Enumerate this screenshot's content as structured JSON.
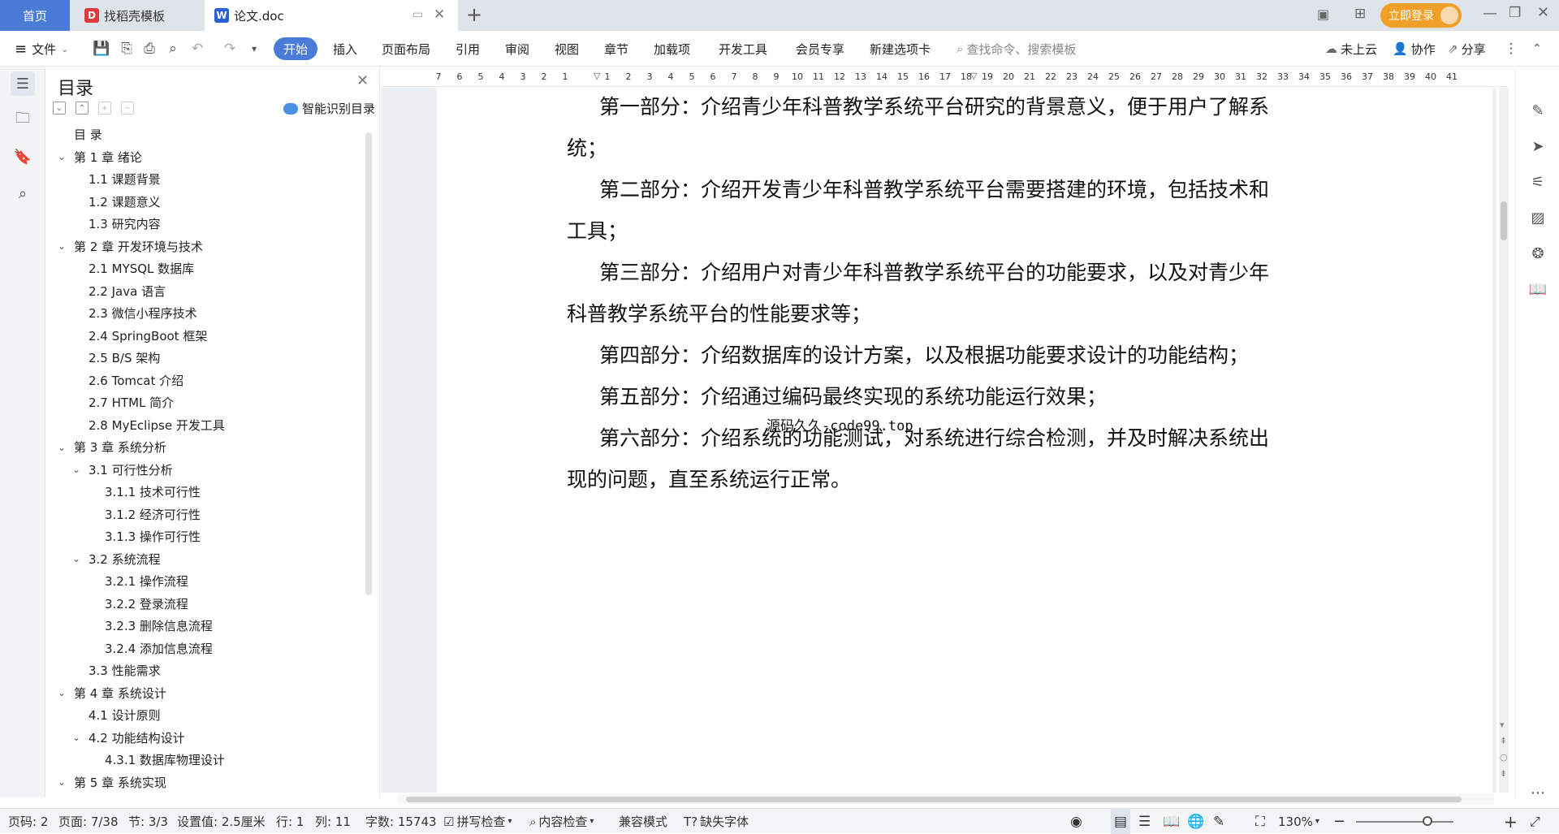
{
  "tabs": {
    "home": "首页",
    "template": "找稻壳模板",
    "document": "论文.doc"
  },
  "titlebar": {
    "login": "立即登录"
  },
  "toolbar": {
    "file": "文件",
    "menus": [
      "开始",
      "插入",
      "页面布局",
      "引用",
      "审阅",
      "视图",
      "章节",
      "加载项",
      "开发工具",
      "会员专享",
      "新建选项卡"
    ],
    "search_placeholder": "查找命令、搜索模板",
    "cloud": "未上云",
    "collab": "协作",
    "share": "分享"
  },
  "toc": {
    "title": "目录",
    "smart": "智能识别目录",
    "items": [
      {
        "label": "目  录",
        "level": 0,
        "chevron": false
      },
      {
        "label": "第 1 章  绪论",
        "level": 0,
        "chevron": true
      },
      {
        "label": "1.1  课题背景",
        "level": 1,
        "chevron": false
      },
      {
        "label": "1.2  课题意义",
        "level": 1,
        "chevron": false
      },
      {
        "label": "1.3  研究内容",
        "level": 1,
        "chevron": false
      },
      {
        "label": "第 2 章  开发环境与技术",
        "level": 0,
        "chevron": true
      },
      {
        "label": "2.1 MYSQL 数据库",
        "level": 1,
        "chevron": false
      },
      {
        "label": "2.2 Java 语言",
        "level": 1,
        "chevron": false
      },
      {
        "label": "2.3  微信小程序技术",
        "level": 1,
        "chevron": false
      },
      {
        "label": "2.4 SpringBoot 框架",
        "level": 1,
        "chevron": false
      },
      {
        "label": "2.5 B/S 架构",
        "level": 1,
        "chevron": false
      },
      {
        "label": "2.6 Tomcat 介绍",
        "level": 1,
        "chevron": false
      },
      {
        "label": "2.7 HTML 简介",
        "level": 1,
        "chevron": false
      },
      {
        "label": "2.8 MyEclipse 开发工具",
        "level": 1,
        "chevron": false
      },
      {
        "label": "第 3 章  系统分析",
        "level": 0,
        "chevron": true
      },
      {
        "label": "3.1  可行性分析",
        "level": 1,
        "chevron": true
      },
      {
        "label": "3.1.1  技术可行性",
        "level": 2,
        "chevron": false
      },
      {
        "label": "3.1.2  经济可行性",
        "level": 2,
        "chevron": false
      },
      {
        "label": "3.1.3  操作可行性",
        "level": 2,
        "chevron": false
      },
      {
        "label": "3.2  系统流程",
        "level": 1,
        "chevron": true
      },
      {
        "label": "3.2.1  操作流程",
        "level": 2,
        "chevron": false
      },
      {
        "label": "3.2.2  登录流程",
        "level": 2,
        "chevron": false
      },
      {
        "label": "3.2.3  删除信息流程",
        "level": 2,
        "chevron": false
      },
      {
        "label": "3.2.4  添加信息流程",
        "level": 2,
        "chevron": false
      },
      {
        "label": "3.3  性能需求",
        "level": 1,
        "chevron": false
      },
      {
        "label": "第 4 章  系统设计",
        "level": 0,
        "chevron": true
      },
      {
        "label": "4.1  设计原则",
        "level": 1,
        "chevron": false
      },
      {
        "label": "4.2  功能结构设计",
        "level": 1,
        "chevron": true
      },
      {
        "label": "4.3.1  数据库物理设计",
        "level": 2,
        "chevron": false
      },
      {
        "label": "第 5 章  系统实现",
        "level": 0,
        "chevron": true
      }
    ]
  },
  "ruler": [
    "7",
    "6",
    "5",
    "4",
    "3",
    "2",
    "1",
    "",
    "1",
    "2",
    "3",
    "4",
    "5",
    "6",
    "7",
    "8",
    "9",
    "10",
    "11",
    "12",
    "13",
    "14",
    "15",
    "16",
    "17",
    "18",
    "19",
    "20",
    "21",
    "22",
    "23",
    "24",
    "25",
    "26",
    "27",
    "28",
    "29",
    "30",
    "31",
    "32",
    "33",
    "34",
    "35",
    "36",
    "37",
    "38",
    "39",
    "40",
    "41"
  ],
  "document": {
    "lines": [
      "第一部分：介绍青少年科普教学系统平台研究的背景意义，便于用户了解系",
      "统；",
      "第二部分：介绍开发青少年科普教学系统平台需要搭建的环境，包括技术和",
      "工具；",
      "第三部分：介绍用户对青少年科普教学系统平台的功能要求，以及对青少年",
      "科普教学系统平台的性能要求等；",
      "第四部分：介绍数据库的设计方案，以及根据功能要求设计的功能结构；",
      "第五部分：介绍通过编码最终实现的系统功能运行效果；",
      "第六部分：介绍系统的功能测试，对系统进行综合检测，并及时解决系统出",
      "现的问题，直至系统运行正常。"
    ],
    "watermark": "源码久久-code99.top"
  },
  "status": {
    "page_num": "页码: 2",
    "pages": "页面: 7/38",
    "section": "节: 3/3",
    "setting": "设置值: 2.5厘米",
    "row": "行: 1",
    "col": "列: 11",
    "words": "字数: 15743",
    "spell": "拼写检查",
    "content": "内容检查",
    "compat": "兼容模式",
    "missing_font": "缺失字体",
    "zoom": "130%"
  }
}
